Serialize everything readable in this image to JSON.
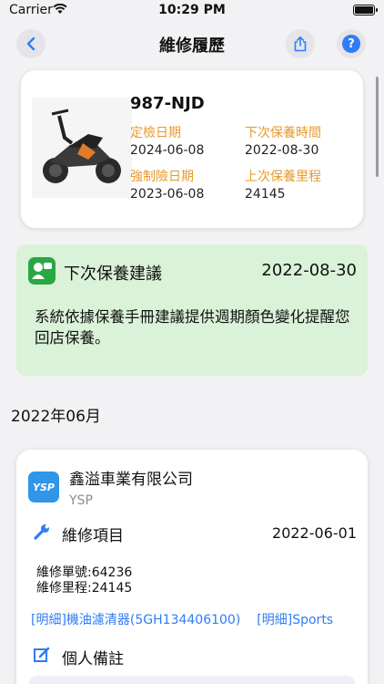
{
  "status": {
    "carrier": "Carrier",
    "time": "10:29 PM"
  },
  "nav": {
    "title": "維修履歷"
  },
  "vehicle": {
    "plate": "987-NJD",
    "inspection_label": "定檢日期",
    "inspection_date": "2024-06-08",
    "next_service_label": "下次保養時間",
    "next_service_date": "2022-08-30",
    "insurance_label": "強制險日期",
    "insurance_date": "2023-06-08",
    "last_mileage_label": "上次保養里程",
    "last_mileage": "24145"
  },
  "suggestion": {
    "title": "下次保養建議",
    "date": "2022-08-30",
    "body": "系統依據保養手冊建議提供週期顏色變化提醒您回店保養。"
  },
  "month_header": "2022年06月",
  "record": {
    "shop_name": "鑫溢車業有限公司",
    "shop_brand": "YSP",
    "shop_logo": "YSP",
    "repair_label": "維修項目",
    "repair_date": "2022-06-01",
    "order_no": "維修單號:64236",
    "mileage": "維修里程:24145",
    "detail_links": [
      "[明細]機油濾清器(5GH134406100)",
      "[明細]Sports"
    ],
    "note_label": "個人備註"
  },
  "colors": {
    "accent": "#2f7cf6",
    "label_orange": "#e79a2c",
    "suggest_bg": "#daf2d7",
    "suggest_icon": "#29a745"
  }
}
